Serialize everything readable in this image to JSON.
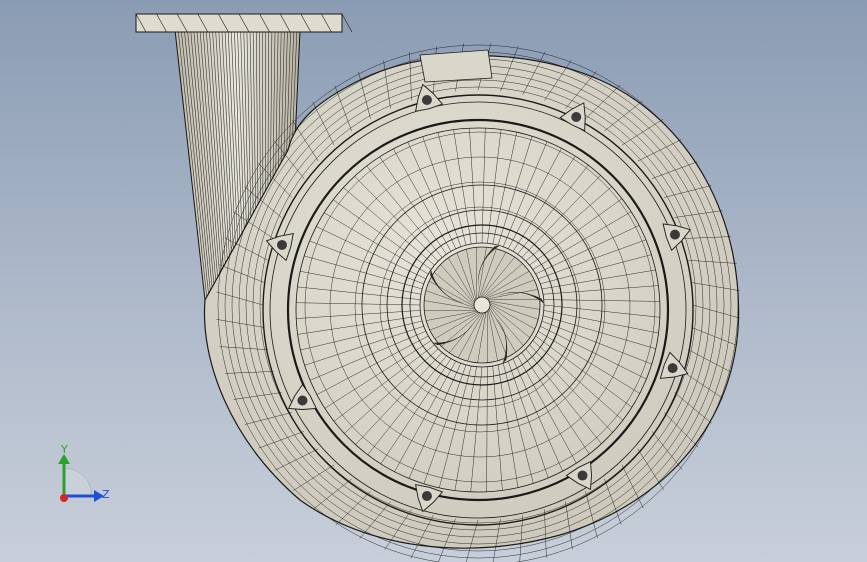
{
  "viewport": {
    "background_top": "#8a9cb3",
    "background_bottom": "#c8cfda",
    "model": {
      "type": "centrifugal pump housing (tessellated wireframe)",
      "surface_color": "#d6d3c6",
      "edge_color": "#1a1a1a",
      "visible_bolt_bosses": 8,
      "visible_impeller_blades": 5
    }
  },
  "triad": {
    "y_label": "Y",
    "z_label": "Z",
    "y_color": "#2ca02c",
    "z_color": "#1f4fd6",
    "x_color": "#d62728"
  }
}
